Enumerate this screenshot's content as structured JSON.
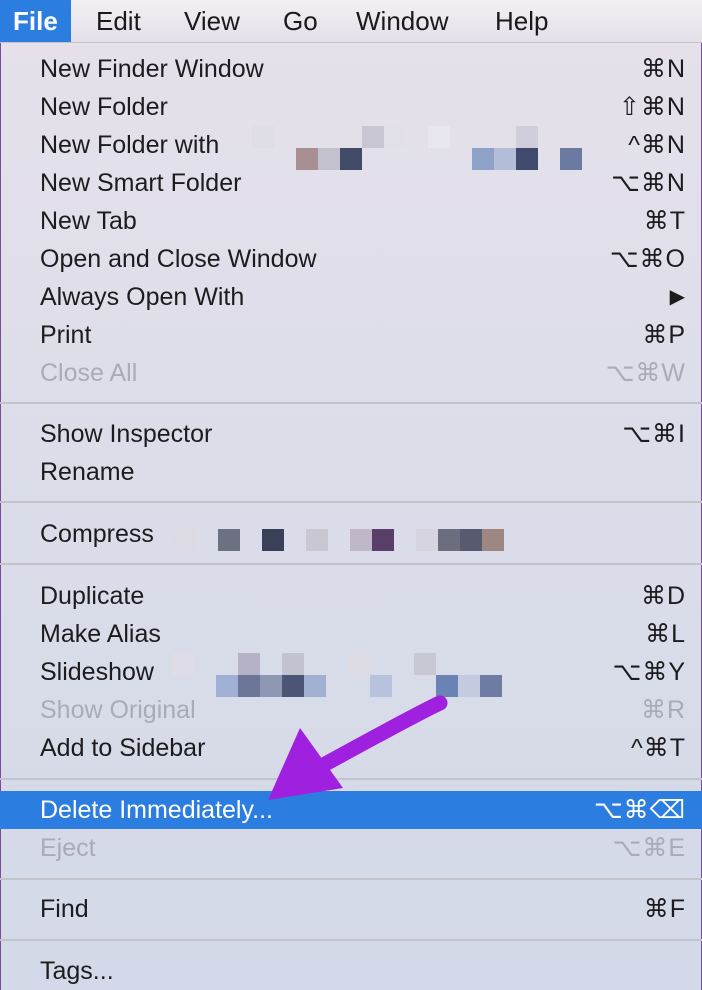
{
  "menubar": {
    "items": [
      {
        "label": "File",
        "active": true
      },
      {
        "label": "Edit"
      },
      {
        "label": "View"
      },
      {
        "label": "Go"
      },
      {
        "label": "Window"
      },
      {
        "label": "Help"
      }
    ]
  },
  "menu": {
    "new_finder_window": {
      "label": "New Finder Window",
      "shortcut": "⌘N"
    },
    "new_folder": {
      "label": "New Folder",
      "shortcut": "⇧⌘N"
    },
    "new_folder_with": {
      "label": "New Folder with",
      "shortcut": "^⌘N"
    },
    "new_smart_folder": {
      "label": "New Smart Folder",
      "shortcut": "⌥⌘N"
    },
    "new_tab": {
      "label": "New Tab",
      "shortcut": "⌘T"
    },
    "open_and_close_window": {
      "label": "Open and Close Window",
      "shortcut": "⌥⌘O"
    },
    "always_open_with": {
      "label": "Always Open With",
      "shortcut": "▶"
    },
    "print": {
      "label": "Print",
      "shortcut": "⌘P"
    },
    "close_all": {
      "label": "Close All",
      "shortcut": "⌥⌘W"
    },
    "show_inspector": {
      "label": "Show Inspector",
      "shortcut": "⌥⌘I"
    },
    "rename": {
      "label": "Rename",
      "shortcut": ""
    },
    "compress": {
      "label": "Compress",
      "shortcut": ""
    },
    "duplicate": {
      "label": "Duplicate",
      "shortcut": "⌘D"
    },
    "make_alias": {
      "label": "Make Alias",
      "shortcut": "⌘L"
    },
    "slideshow": {
      "label": "Slideshow",
      "shortcut": "⌥⌘Y"
    },
    "show_original": {
      "label": "Show Original",
      "shortcut": "⌘R"
    },
    "add_to_sidebar": {
      "label": "Add to Sidebar",
      "shortcut": "^⌘T"
    },
    "delete_immediately": {
      "label": "Delete Immediately...",
      "shortcut": "⌥⌘⌫"
    },
    "eject": {
      "label": "Eject",
      "shortcut": "⌥⌘E"
    },
    "find": {
      "label": "Find",
      "shortcut": "⌘F"
    },
    "tags": {
      "label": "Tags...",
      "shortcut": ""
    }
  },
  "colors": {
    "highlight": "#2c7de0",
    "arrow": "#a020e0",
    "disabled_text": "#a9abb6"
  }
}
